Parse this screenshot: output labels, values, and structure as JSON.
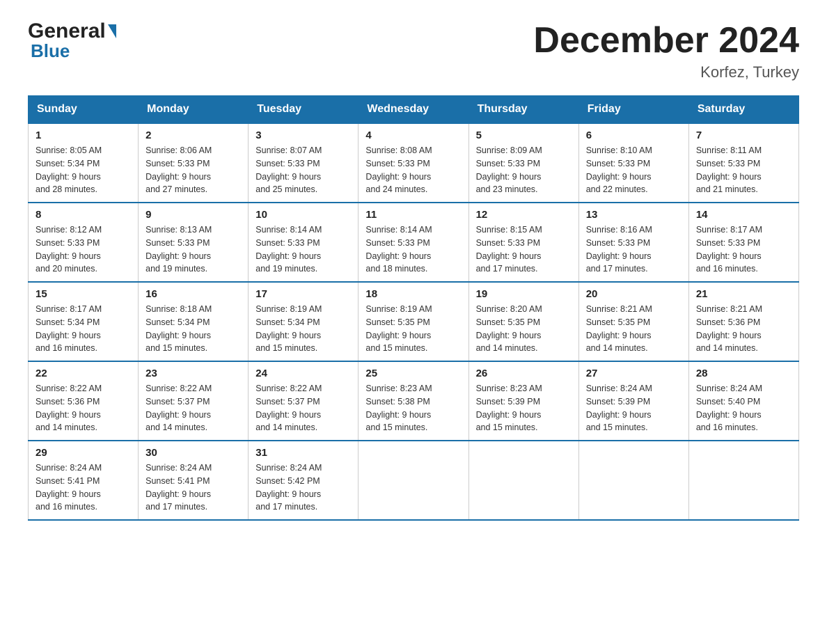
{
  "logo": {
    "general": "General",
    "blue": "Blue"
  },
  "title": {
    "month": "December 2024",
    "location": "Korfez, Turkey"
  },
  "headers": [
    "Sunday",
    "Monday",
    "Tuesday",
    "Wednesday",
    "Thursday",
    "Friday",
    "Saturday"
  ],
  "weeks": [
    [
      {
        "day": "1",
        "sunrise": "8:05 AM",
        "sunset": "5:34 PM",
        "daylight": "9 hours and 28 minutes."
      },
      {
        "day": "2",
        "sunrise": "8:06 AM",
        "sunset": "5:33 PM",
        "daylight": "9 hours and 27 minutes."
      },
      {
        "day": "3",
        "sunrise": "8:07 AM",
        "sunset": "5:33 PM",
        "daylight": "9 hours and 25 minutes."
      },
      {
        "day": "4",
        "sunrise": "8:08 AM",
        "sunset": "5:33 PM",
        "daylight": "9 hours and 24 minutes."
      },
      {
        "day": "5",
        "sunrise": "8:09 AM",
        "sunset": "5:33 PM",
        "daylight": "9 hours and 23 minutes."
      },
      {
        "day": "6",
        "sunrise": "8:10 AM",
        "sunset": "5:33 PM",
        "daylight": "9 hours and 22 minutes."
      },
      {
        "day": "7",
        "sunrise": "8:11 AM",
        "sunset": "5:33 PM",
        "daylight": "9 hours and 21 minutes."
      }
    ],
    [
      {
        "day": "8",
        "sunrise": "8:12 AM",
        "sunset": "5:33 PM",
        "daylight": "9 hours and 20 minutes."
      },
      {
        "day": "9",
        "sunrise": "8:13 AM",
        "sunset": "5:33 PM",
        "daylight": "9 hours and 19 minutes."
      },
      {
        "day": "10",
        "sunrise": "8:14 AM",
        "sunset": "5:33 PM",
        "daylight": "9 hours and 19 minutes."
      },
      {
        "day": "11",
        "sunrise": "8:14 AM",
        "sunset": "5:33 PM",
        "daylight": "9 hours and 18 minutes."
      },
      {
        "day": "12",
        "sunrise": "8:15 AM",
        "sunset": "5:33 PM",
        "daylight": "9 hours and 17 minutes."
      },
      {
        "day": "13",
        "sunrise": "8:16 AM",
        "sunset": "5:33 PM",
        "daylight": "9 hours and 17 minutes."
      },
      {
        "day": "14",
        "sunrise": "8:17 AM",
        "sunset": "5:33 PM",
        "daylight": "9 hours and 16 minutes."
      }
    ],
    [
      {
        "day": "15",
        "sunrise": "8:17 AM",
        "sunset": "5:34 PM",
        "daylight": "9 hours and 16 minutes."
      },
      {
        "day": "16",
        "sunrise": "8:18 AM",
        "sunset": "5:34 PM",
        "daylight": "9 hours and 15 minutes."
      },
      {
        "day": "17",
        "sunrise": "8:19 AM",
        "sunset": "5:34 PM",
        "daylight": "9 hours and 15 minutes."
      },
      {
        "day": "18",
        "sunrise": "8:19 AM",
        "sunset": "5:35 PM",
        "daylight": "9 hours and 15 minutes."
      },
      {
        "day": "19",
        "sunrise": "8:20 AM",
        "sunset": "5:35 PM",
        "daylight": "9 hours and 14 minutes."
      },
      {
        "day": "20",
        "sunrise": "8:21 AM",
        "sunset": "5:35 PM",
        "daylight": "9 hours and 14 minutes."
      },
      {
        "day": "21",
        "sunrise": "8:21 AM",
        "sunset": "5:36 PM",
        "daylight": "9 hours and 14 minutes."
      }
    ],
    [
      {
        "day": "22",
        "sunrise": "8:22 AM",
        "sunset": "5:36 PM",
        "daylight": "9 hours and 14 minutes."
      },
      {
        "day": "23",
        "sunrise": "8:22 AM",
        "sunset": "5:37 PM",
        "daylight": "9 hours and 14 minutes."
      },
      {
        "day": "24",
        "sunrise": "8:22 AM",
        "sunset": "5:37 PM",
        "daylight": "9 hours and 14 minutes."
      },
      {
        "day": "25",
        "sunrise": "8:23 AM",
        "sunset": "5:38 PM",
        "daylight": "9 hours and 15 minutes."
      },
      {
        "day": "26",
        "sunrise": "8:23 AM",
        "sunset": "5:39 PM",
        "daylight": "9 hours and 15 minutes."
      },
      {
        "day": "27",
        "sunrise": "8:24 AM",
        "sunset": "5:39 PM",
        "daylight": "9 hours and 15 minutes."
      },
      {
        "day": "28",
        "sunrise": "8:24 AM",
        "sunset": "5:40 PM",
        "daylight": "9 hours and 16 minutes."
      }
    ],
    [
      {
        "day": "29",
        "sunrise": "8:24 AM",
        "sunset": "5:41 PM",
        "daylight": "9 hours and 16 minutes."
      },
      {
        "day": "30",
        "sunrise": "8:24 AM",
        "sunset": "5:41 PM",
        "daylight": "9 hours and 17 minutes."
      },
      {
        "day": "31",
        "sunrise": "8:24 AM",
        "sunset": "5:42 PM",
        "daylight": "9 hours and 17 minutes."
      },
      null,
      null,
      null,
      null
    ]
  ],
  "labels": {
    "sunrise": "Sunrise:",
    "sunset": "Sunset:",
    "daylight": "Daylight:"
  }
}
